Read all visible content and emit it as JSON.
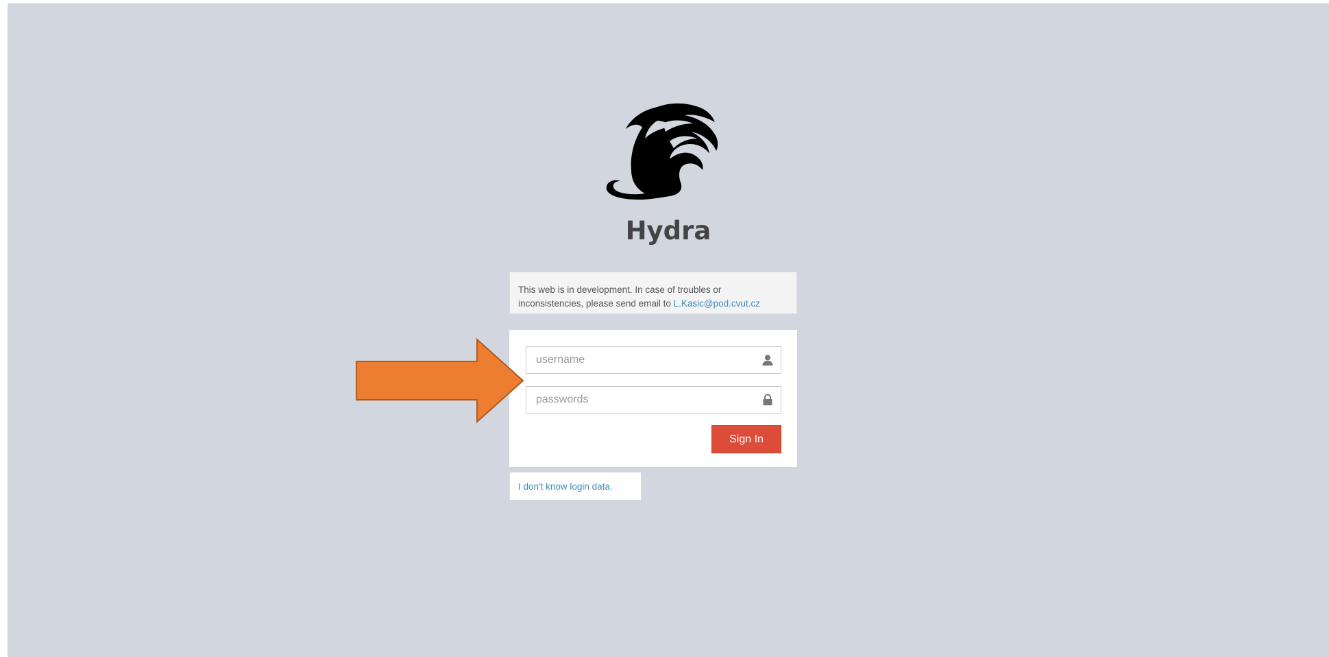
{
  "brand": {
    "title": "Hydra"
  },
  "notice": {
    "text": "This web is in development. In case of troubles or inconsistencies, please send email to ",
    "email_link": "L.Kasic@pod.cvut.cz"
  },
  "login": {
    "username_placeholder": "username",
    "password_placeholder": "passwords",
    "username_icon": "user-icon",
    "password_icon": "lock-icon",
    "signin_label": "Sign In"
  },
  "help": {
    "link_text": "I don't know login data."
  },
  "colors": {
    "background": "#d2d6de",
    "signin_button": "#dd4b39",
    "link": "#3c8dbc",
    "arrow_fill": "#ed7d31",
    "arrow_stroke": "#ae5a21"
  }
}
